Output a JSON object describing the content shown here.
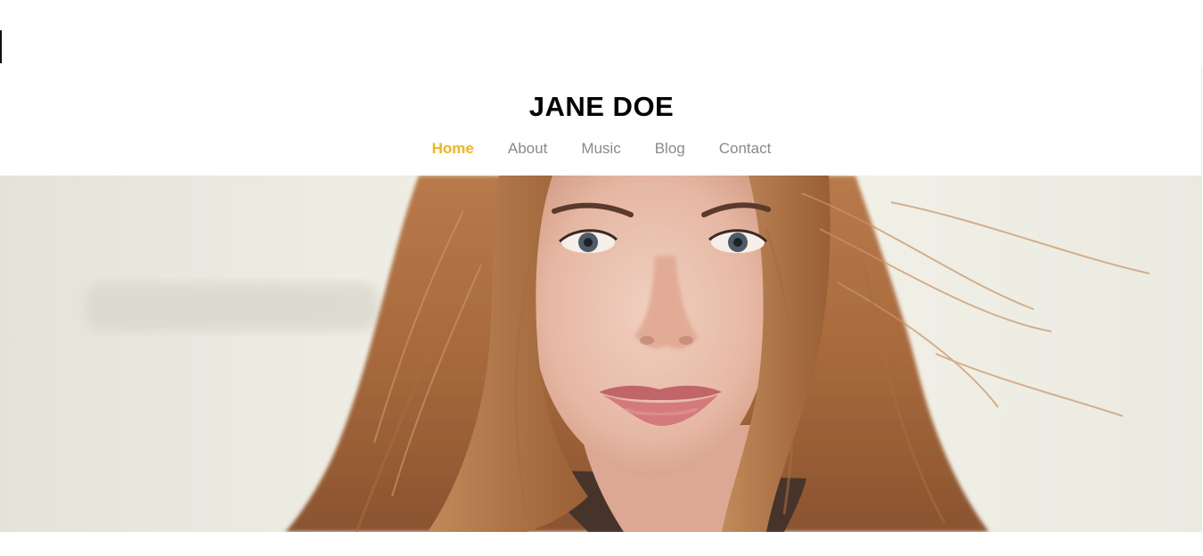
{
  "site": {
    "title": "JANE DOE"
  },
  "nav": {
    "items": [
      {
        "label": "Home",
        "active": true
      },
      {
        "label": "About",
        "active": false
      },
      {
        "label": "Music",
        "active": false
      },
      {
        "label": "Blog",
        "active": false
      },
      {
        "label": "Contact",
        "active": false
      }
    ]
  },
  "hero": {
    "image": "portrait-photo",
    "subject": "woman with long auburn hair"
  },
  "colors": {
    "accent": "#f2b51d",
    "nav_text": "#8a8a8a",
    "title_text": "#000000",
    "background": "#ffffff"
  }
}
